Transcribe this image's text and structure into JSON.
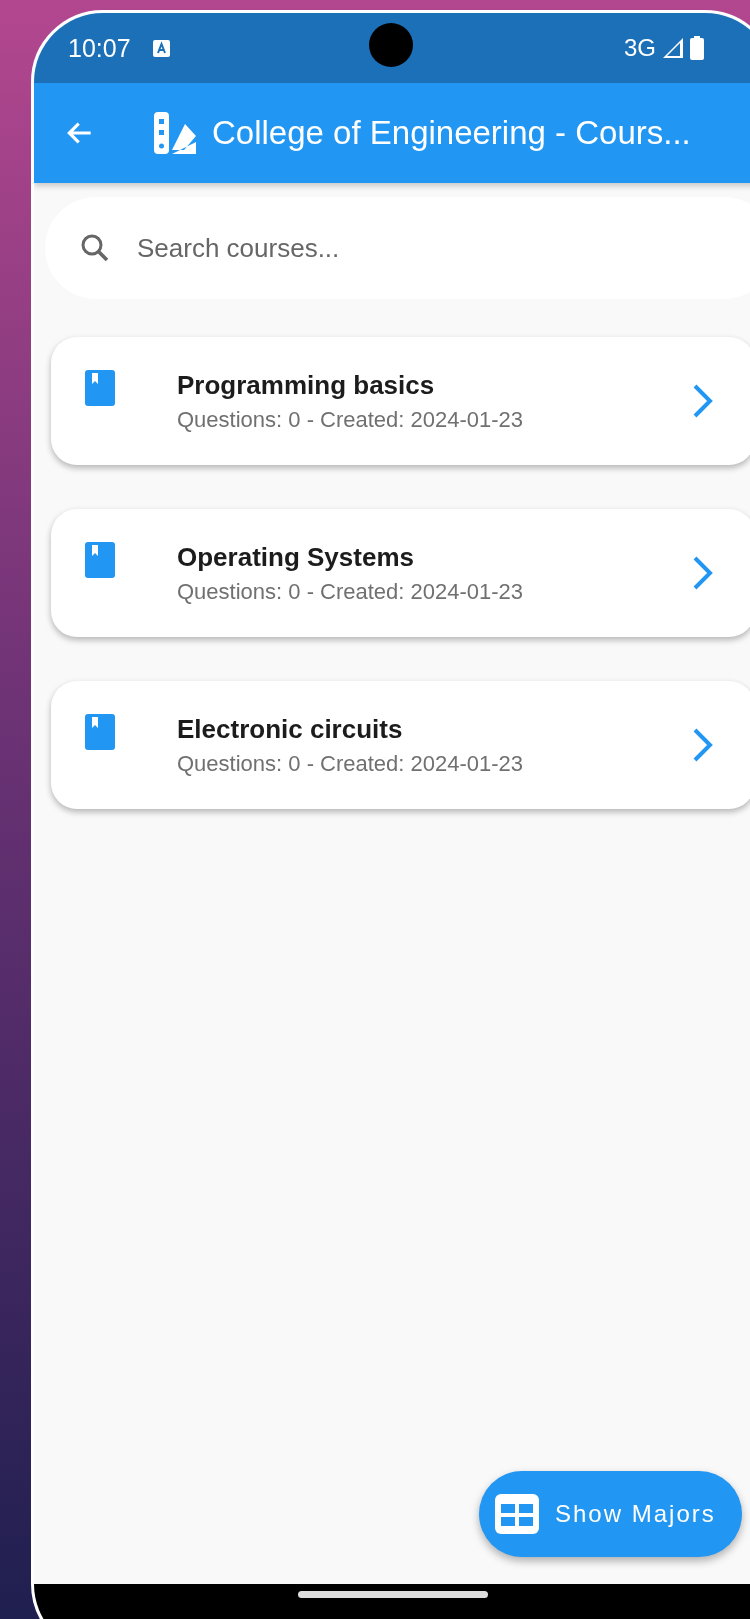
{
  "status_bar": {
    "time": "10:07",
    "network": "3G"
  },
  "app_bar": {
    "title": "College of Engineering - Cours..."
  },
  "search": {
    "placeholder": "Search courses..."
  },
  "courses": [
    {
      "title": "Programming basics",
      "subtitle": "Questions: 0 - Created: 2024-01-23"
    },
    {
      "title": "Operating Systems",
      "subtitle": "Questions: 0 - Created: 2024-01-23"
    },
    {
      "title": "Electronic circuits",
      "subtitle": "Questions: 0 - Created: 2024-01-23"
    }
  ],
  "fab": {
    "label": "Show Majors"
  }
}
